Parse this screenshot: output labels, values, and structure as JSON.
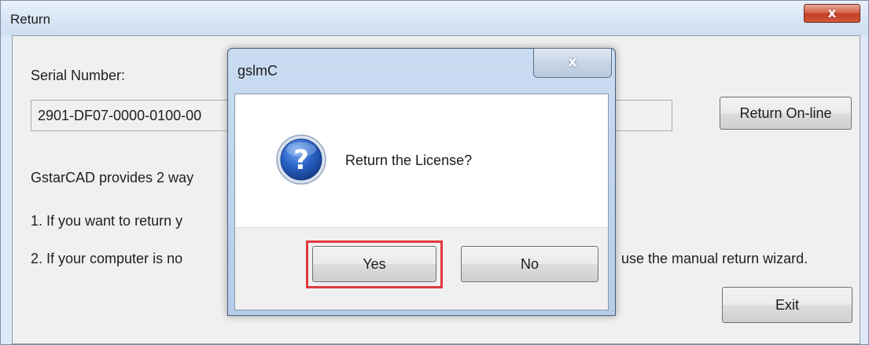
{
  "main_window": {
    "title": "Return",
    "close_glyph": "x",
    "serial_label": "Serial Number:",
    "serial_value": "2901-DF07-0000-0100-00",
    "return_online_label": "Return On-line",
    "info_text": "GstarCAD provides 2 way",
    "item_1": "1.  If you want to return y",
    "item_2_left": "2.  If your computer is no",
    "item_2_right": "use the manual return wizard.",
    "exit_label": "Exit"
  },
  "message_box": {
    "title": "gslmC",
    "close_glyph": "x",
    "icon": "question-icon",
    "message": "Return the License?",
    "yes_label": "Yes",
    "no_label": "No"
  },
  "colors": {
    "highlight": "#e0393e",
    "icon_blue": "#1d4fa8",
    "close_red": "#c23c22"
  }
}
